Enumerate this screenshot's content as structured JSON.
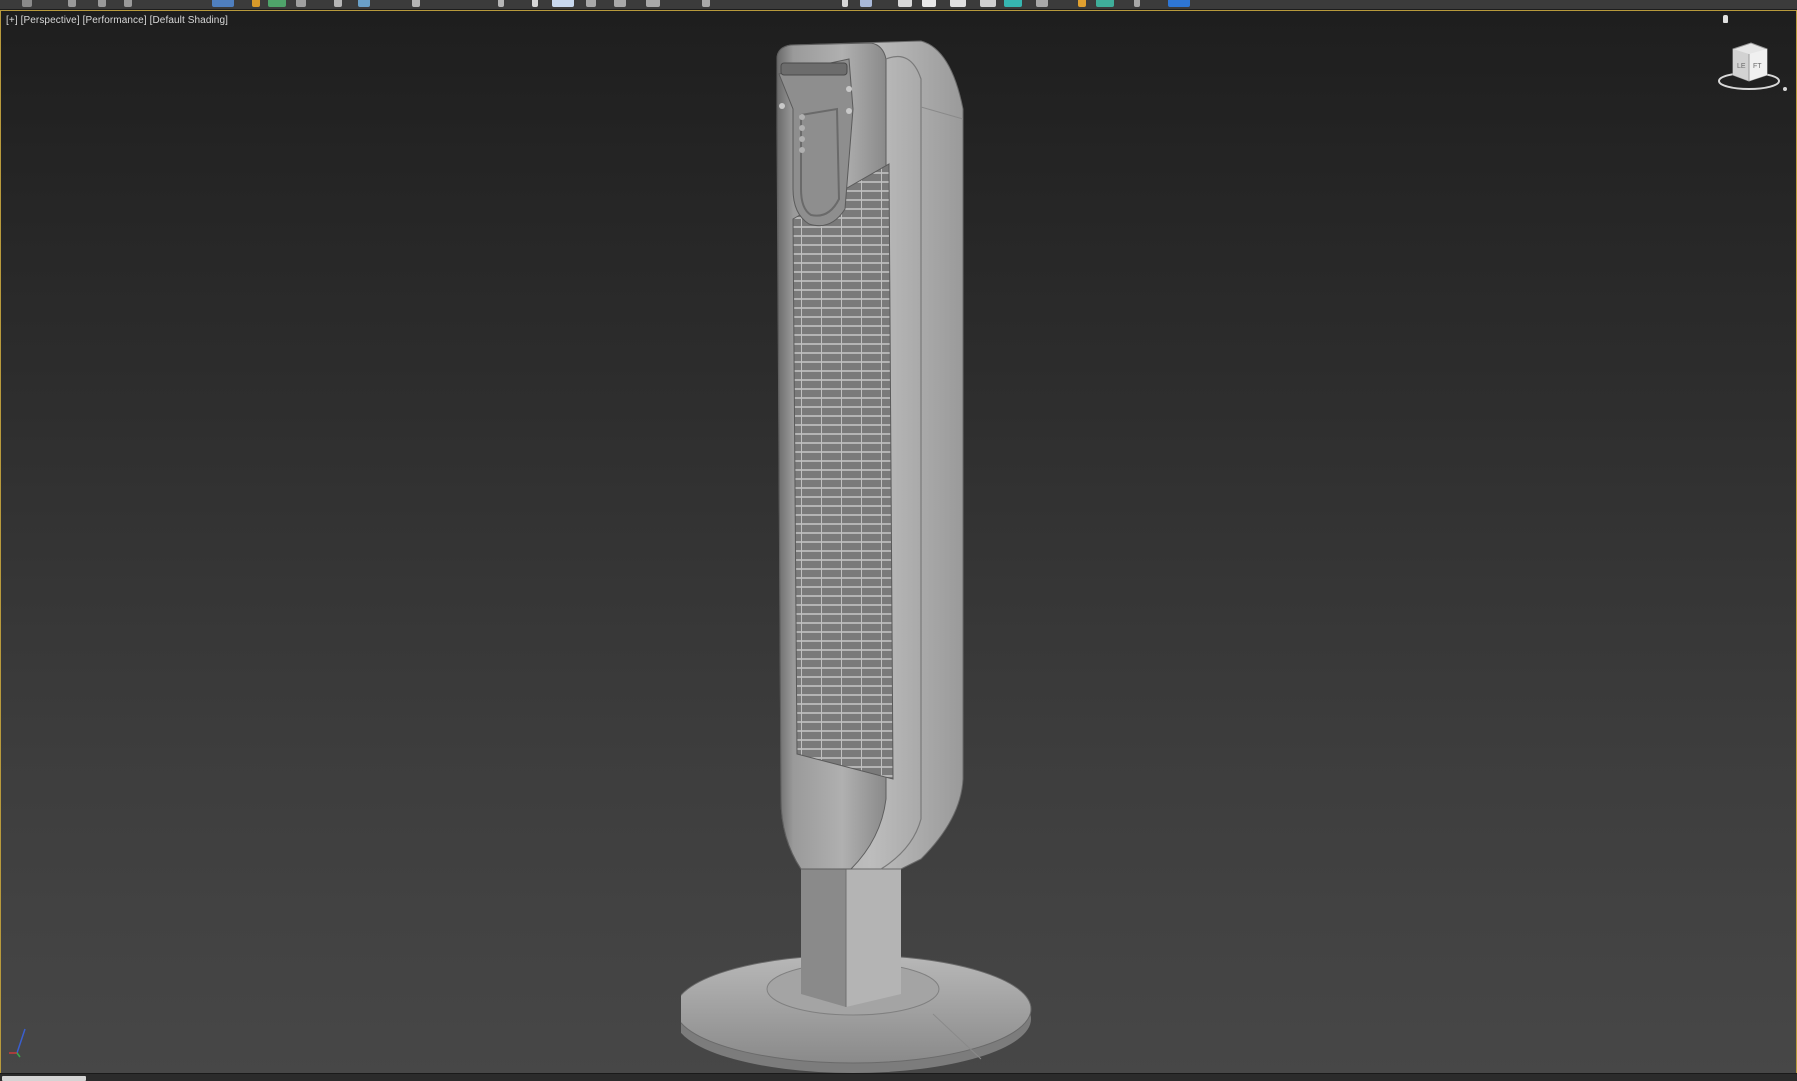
{
  "viewport": {
    "label_plus": "[+]",
    "label_view": "[Perspective]",
    "label_mode": "[Performance]",
    "label_shading": "[Default Shading]"
  },
  "viewcube": {
    "face_left": "LE",
    "face_right": "FT"
  },
  "colors": {
    "viewport_border": "#b89a3c",
    "accent_blue": "#2e76d4",
    "toolbar_bg": "#3b3b3b"
  },
  "icons": [
    "select-icon",
    "move-icon",
    "rotate-icon",
    "scale-icon",
    "snap-icon",
    "mirror-icon",
    "align-icon",
    "render-icon",
    "material-editor-icon"
  ]
}
